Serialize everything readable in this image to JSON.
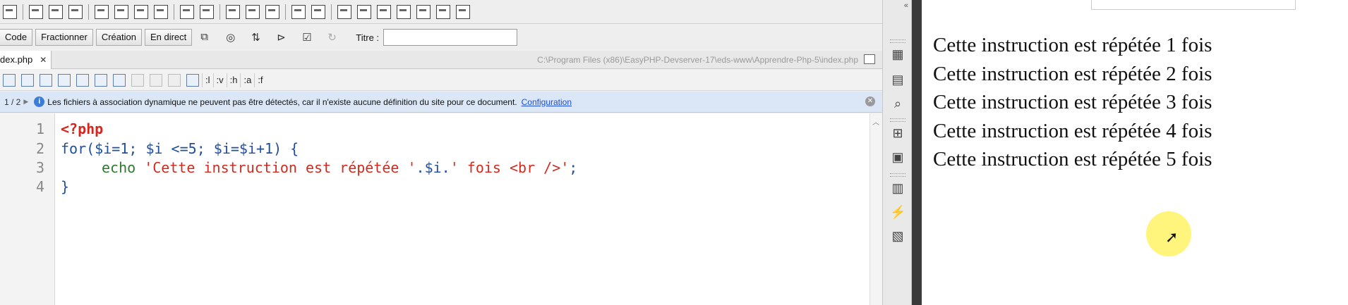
{
  "editor": {
    "view_buttons": [
      "Code",
      "Fractionner",
      "Création",
      "En direct"
    ],
    "title_label": "Titre :",
    "title_value": "",
    "tab_name": "dex.php",
    "file_path": "C:\\Program Files (x86)\\EasyPHP-Devserver-17\\eds-www\\Apprendre-Php-5\\index.php",
    "css_tools": [
      ":l",
      ":v",
      ":h",
      ":a",
      ":f"
    ],
    "info_page": "1 / 2",
    "info_message": "Les fichiers à association dynamique ne peuvent pas être détectés, car il n'existe aucune définition du site pour ce document.",
    "info_link": "Configuration",
    "line_numbers": [
      "1",
      "2",
      "3",
      "4"
    ],
    "code": {
      "line1": "<?php",
      "line2_for": "for(",
      "line2_init": "$i=1",
      "line2_sep1": "; ",
      "line2_cond": "$i <=5",
      "line2_sep2": "; ",
      "line2_inc": "$i=$i+1",
      "line2_end": ") {",
      "line3_echo": "echo ",
      "line3_str1": "'Cette instruction est répétée '",
      "line3_concat1": ".$i.",
      "line3_str2": "' fois <br />'",
      "line3_end": ";",
      "line4": "}"
    }
  },
  "output": {
    "lines": [
      "Cette instruction est répétée 1 fois",
      "Cette instruction est répétée 2 fois",
      "Cette instruction est répétée 3 fois",
      "Cette instruction est répétée 4 fois",
      "Cette instruction est répétée 5 fois"
    ]
  },
  "icons": {
    "panel": [
      "assets-icon",
      "insert-icon",
      "inspect-icon",
      "sitemap-icon",
      "files-icon",
      "library-icon",
      "behaviors-icon",
      "snippets-icon"
    ]
  },
  "colors": {
    "php_tag": "#d4261f",
    "keyword": "#1f4fa0",
    "string": "#d02b1f",
    "echo": "#2f7a2f",
    "info_bar": "#dbe7f6",
    "link": "#1a4ed8"
  }
}
